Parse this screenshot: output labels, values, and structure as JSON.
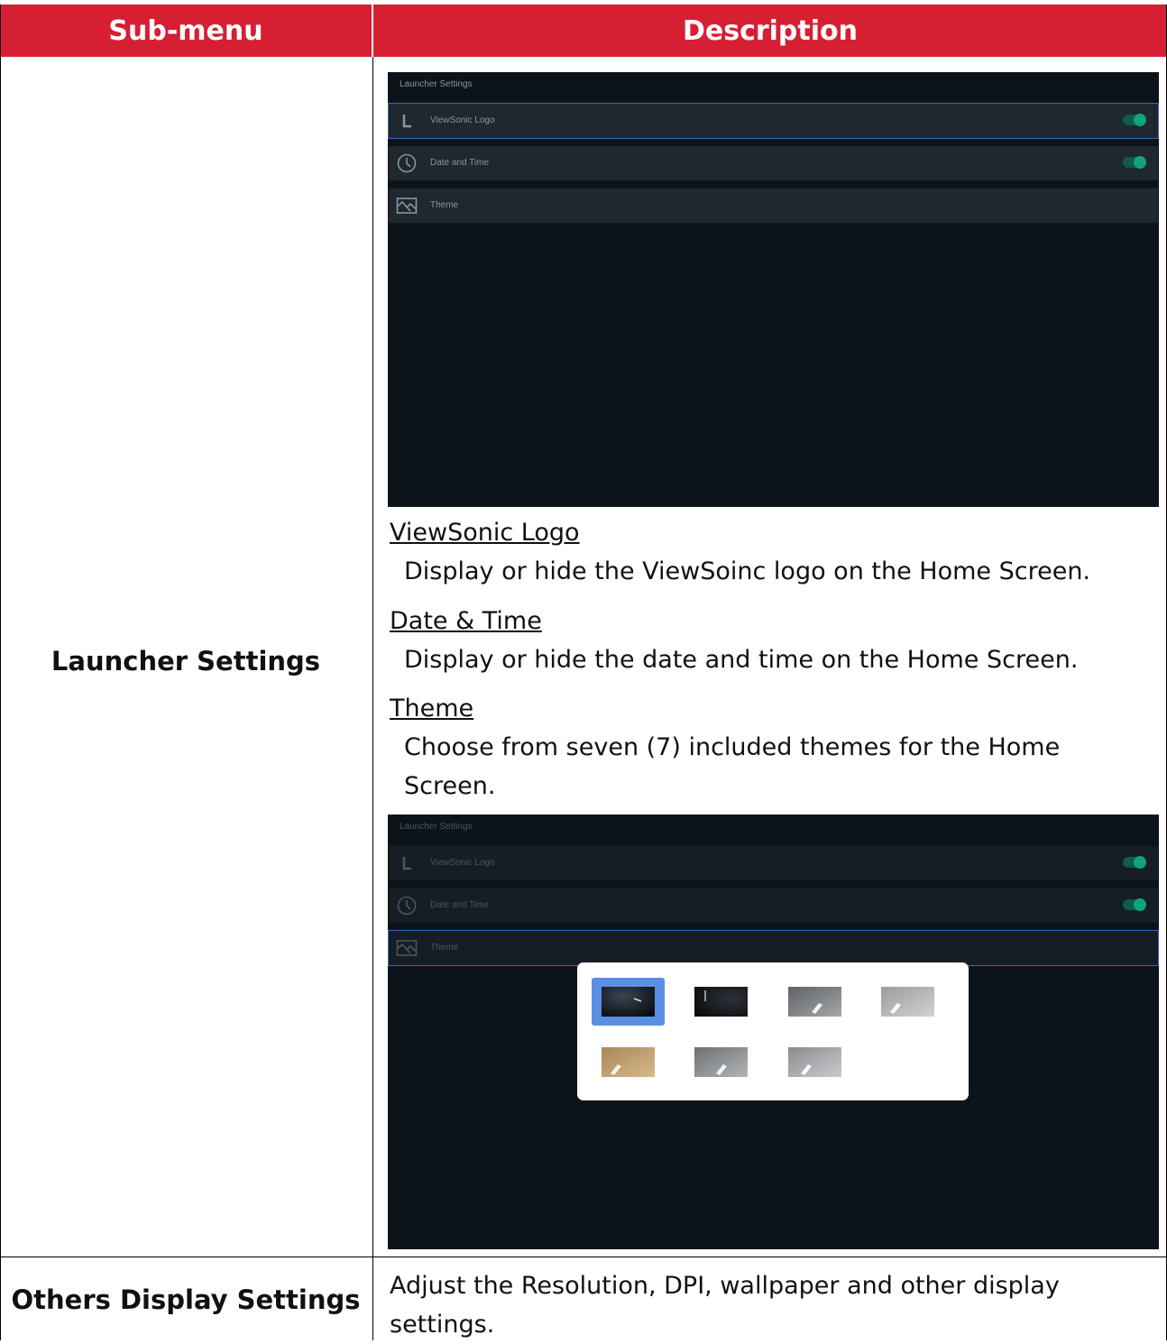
{
  "header": {
    "col1": "Sub-menu",
    "col2": "Description"
  },
  "rows": [
    {
      "submenu": "Launcher Settings",
      "screenshot1": {
        "title": "Launcher Settings",
        "items": [
          {
            "label": "ViewSonic Logo",
            "icon": "logo-l-icon",
            "toggle": true
          },
          {
            "label": "Date and Time",
            "icon": "clock-icon",
            "toggle": true
          },
          {
            "label": "Theme",
            "icon": "image-icon",
            "toggle": false
          }
        ]
      },
      "sections": [
        {
          "heading": "ViewSonic Logo",
          "text": "Display or hide the ViewSoinc logo on the Home Screen."
        },
        {
          "heading": "Date & Time",
          "text": "Display or hide the date and time on the Home Screen."
        },
        {
          "heading": "Theme",
          "text": "Choose from seven (7) included themes for the Home Screen."
        }
      ],
      "screenshot2": {
        "title": "Launcher Settings",
        "items": [
          {
            "label": "ViewSonic Logo"
          },
          {
            "label": "Date and Time"
          },
          {
            "label": "Theme"
          }
        ],
        "theme_count": 7,
        "selected_theme": 1
      }
    },
    {
      "submenu": "Others Display Settings",
      "description": "Adjust the Resolution, DPI, wallpaper and other display settings."
    }
  ],
  "colors": {
    "header": "#d61f33",
    "toggle_on": "#12a27f",
    "selection": "#5b8ee5"
  }
}
